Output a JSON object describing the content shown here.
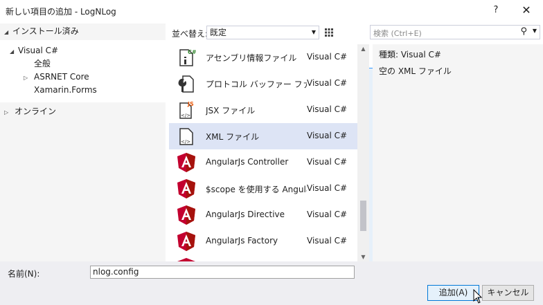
{
  "window": {
    "title": "新しい項目の追加 - LogNLog",
    "help_label": "?",
    "close_label": "✕"
  },
  "left_pane": {
    "installed_label": "インストール済み",
    "tree": [
      {
        "label": "Visual C#",
        "expanded": true
      },
      {
        "label": "全般"
      },
      {
        "label": "ASRNET Core",
        "collapsed_arrow": true
      },
      {
        "label": "Xamarin.Forms"
      }
    ],
    "online_label": "オンライン"
  },
  "sort": {
    "label": "並べ替え:",
    "value": "既定",
    "dropdown_icon": "chevron-down-icon"
  },
  "view_buttons": {
    "grid_icon": "grid-view-icon",
    "list_icon": "list-view-icon"
  },
  "search": {
    "placeholder": "検索 (Ctrl+E)",
    "icon": "search-icon"
  },
  "templates": [
    {
      "name": "アセンブリ情報ファイル",
      "lang": "Visual C#",
      "icon": "assembly-info-icon"
    },
    {
      "name": "プロトコル バッファー ファイル",
      "lang": "Visual C#",
      "icon": "wrench-file-icon"
    },
    {
      "name": "JSX ファイル",
      "lang": "Visual C#",
      "icon": "jsx-file-icon"
    },
    {
      "name": "XML ファイル",
      "lang": "Visual C#",
      "icon": "xml-file-icon",
      "selected": true
    },
    {
      "name": "AngularJs Controller",
      "lang": "Visual C#",
      "icon": "angular-icon"
    },
    {
      "name": "$scope を使用する Angular...",
      "lang": "Visual C#",
      "icon": "angular-icon"
    },
    {
      "name": "AngularJs Directive",
      "lang": "Visual C#",
      "icon": "angular-icon"
    },
    {
      "name": "AngularJs Factory",
      "lang": "Visual C#",
      "icon": "angular-icon"
    }
  ],
  "details": {
    "type_line": "種類:  Visual C#",
    "description": "空の XML ファイル"
  },
  "name_field": {
    "label": "名前(N):",
    "value": "nlog.config"
  },
  "buttons": {
    "add": "追加(A)",
    "cancel": "キャンセル"
  },
  "colors": {
    "accent": "#0078d7",
    "selection": "#dde4f5",
    "angular_red": "#c3002f"
  }
}
